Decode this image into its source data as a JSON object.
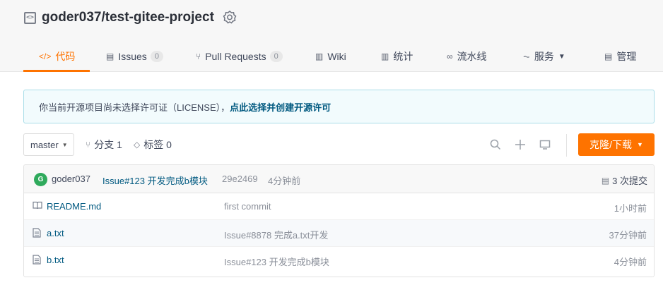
{
  "repo": {
    "name": "goder037/test-gitee-project",
    "repo_icon": "code-brackets-icon",
    "badge_icon": "award-badge-icon"
  },
  "tabs": [
    {
      "label": "代码",
      "icon": "code-icon",
      "glyph": "</>",
      "active": true
    },
    {
      "label": "Issues",
      "icon": "issues-icon",
      "glyph": "▤",
      "count": "0"
    },
    {
      "label": "Pull Requests",
      "icon": "pull-request-icon",
      "glyph": "⑂",
      "count": "0"
    },
    {
      "label": "Wiki",
      "icon": "wiki-icon",
      "glyph": "▥"
    },
    {
      "label": "统计",
      "icon": "stats-icon",
      "glyph": "▥"
    },
    {
      "label": "流水线",
      "icon": "pipeline-icon",
      "glyph": "∞"
    },
    {
      "label": "服务",
      "icon": "service-icon",
      "glyph": "⏦"
    },
    {
      "label": "管理",
      "icon": "manage-icon",
      "glyph": "▤"
    }
  ],
  "notice": {
    "text": "你当前开源项目尚未选择许可证（LICENSE），",
    "link": "点此选择并创建开源许可"
  },
  "toolbar": {
    "branch": "master",
    "branches_label": "分支 1",
    "tags_label": "标签 0",
    "clone_label": "克隆/下载"
  },
  "latest_commit": {
    "avatar_letter": "G",
    "author": "goder037",
    "message": "Issue#123 开发完成b模块",
    "sha": "29e2469",
    "time": "4分钟前",
    "count_label": "3 次提交"
  },
  "files": [
    {
      "name": "README.md",
      "icon": "readme-icon",
      "commit": "first commit",
      "time": "1小时前"
    },
    {
      "name": "a.txt",
      "icon": "file-icon",
      "commit": "Issue#8878 完成a.txt开发",
      "time": "37分钟前"
    },
    {
      "name": "b.txt",
      "icon": "file-icon",
      "commit": "Issue#123 开发完成b模块",
      "time": "4分钟前"
    }
  ],
  "colors": {
    "accent": "#fe7300",
    "link": "#005980",
    "notice_bg": "#f2fbfd"
  }
}
